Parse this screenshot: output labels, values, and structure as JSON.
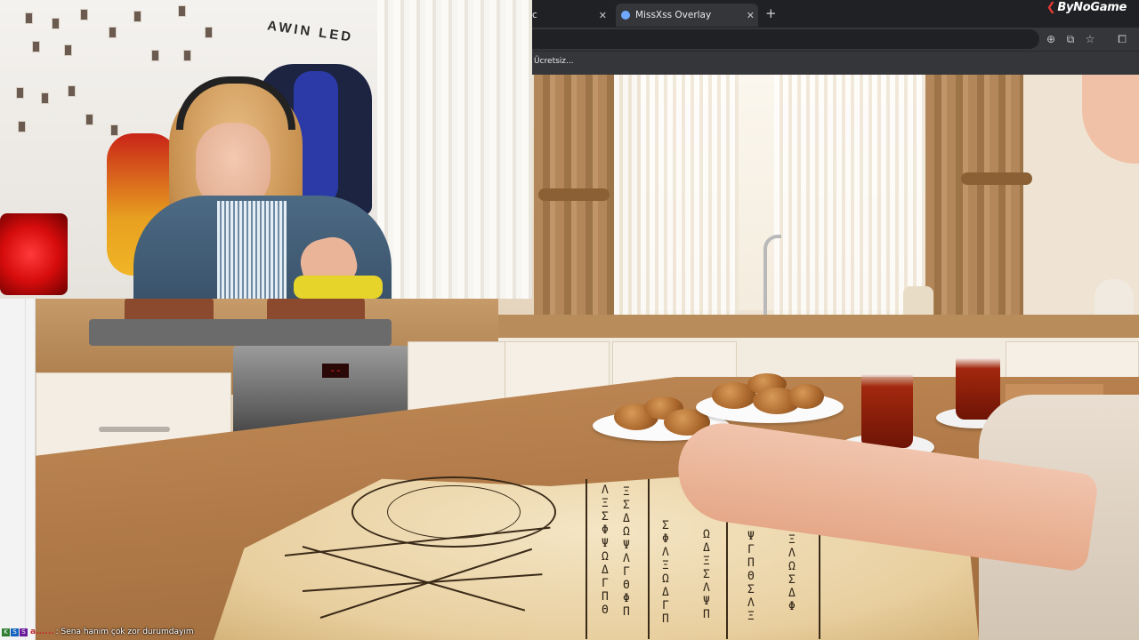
{
  "browser": {
    "tabs": [
      {
        "label": "c",
        "active": false
      },
      {
        "label": "MissXss Overlay",
        "active": true
      }
    ],
    "new_tab_symbol": "+",
    "close_symbol": "✕",
    "brand": "ByNoGame",
    "bookmarks_bar": {
      "item": "Ücretsiz..."
    },
    "toolbar_icons": [
      "zoom-icon",
      "screenshot-icon",
      "star-icon",
      "extensions-icon"
    ]
  },
  "webcam": {
    "wall_logo": "AWIN LED"
  },
  "scene": {
    "oven_display": "--"
  },
  "chat": {
    "badges": [
      "K",
      "S",
      "S"
    ],
    "username": "a......",
    "message": ": Sena hanım çok zor durumdayım"
  },
  "colors": {
    "browser_bg": "#202124",
    "toolbar_bg": "#35363a",
    "brand_accent": "#e53935",
    "chat_username": "#c1272d"
  }
}
